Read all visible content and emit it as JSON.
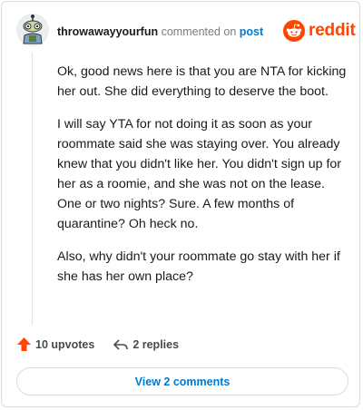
{
  "comment": {
    "author": "throwawayyourfun",
    "action": "commented on",
    "target": "post",
    "paragraphs": [
      "Ok, good news here is that you are NTA for kicking her out. She did everything to deserve the boot.",
      "I will say YTA for not doing it as soon as your roommate said she was staying over. You already knew that you didn't like her. You didn't sign up for her as a roomie, and she was not on the lease. One or two nights? Sure. A few months of quarantine? Oh heck no.",
      "Also, why didn't your roommate go stay with her if she has her own place?"
    ],
    "upvotes": "10 upvotes",
    "replies": "2 replies"
  },
  "brand": {
    "wordmark": "reddit",
    "color": "#ff4500"
  },
  "footer": {
    "view_comments": "View 2 comments"
  },
  "icons": [
    "avatar",
    "reddit-snoo-icon",
    "upvote-arrow-icon",
    "reply-arrow-icon"
  ]
}
